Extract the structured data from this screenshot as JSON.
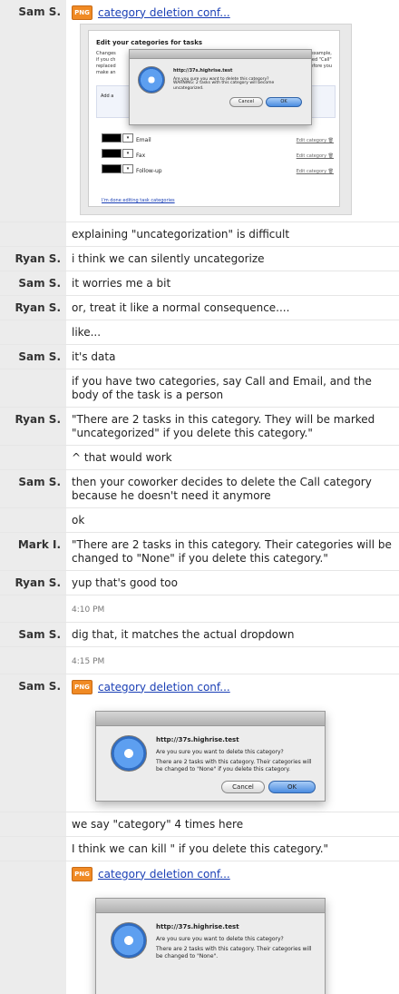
{
  "messages": [
    {
      "author": "Sam S.",
      "file": "category deletion conf..."
    },
    {
      "author": "",
      "text": "explaining \"uncategorization\" is difficult"
    },
    {
      "author": "Ryan S.",
      "text": "i think we can silently uncategorize"
    },
    {
      "author": "Sam S.",
      "text": "it worries me a bit"
    },
    {
      "author": "Ryan S.",
      "text": "or, treat it like a normal consequence...."
    },
    {
      "author": "",
      "text": "like..."
    },
    {
      "author": "Sam S.",
      "text": "it's data"
    },
    {
      "author": "",
      "text": "if you have two categories, say Call and Email, and the body of the task is a person"
    },
    {
      "author": "Ryan S.",
      "text": "\"There are 2 tasks in this category. They will be marked \"uncategorized\" if you delete this category.\""
    },
    {
      "author": "",
      "text": "^ that would work"
    },
    {
      "author": "Sam S.",
      "text": "then your coworker decides to delete the Call category because he doesn't need it anymore"
    },
    {
      "author": "",
      "text": "ok"
    },
    {
      "author": "Mark I.",
      "text": "\"There are 2 tasks in this category. Their categories will be changed to \"None\" if you delete this category.\""
    },
    {
      "author": "Ryan S.",
      "text": "yup that's good too"
    },
    {
      "time": "4:10 PM"
    },
    {
      "author": "Sam S.",
      "text": "dig that, it matches the actual dropdown"
    },
    {
      "time": "4:15 PM"
    },
    {
      "author": "Sam S.",
      "file": "category deletion conf..."
    },
    {
      "author": "",
      "text": "we say \"category\" 4 times here"
    },
    {
      "author": "",
      "text": "I think we can kill \" if you delete this category.\""
    },
    {
      "author": "",
      "file": "category deletion conf..."
    }
  ],
  "file_icon_label": "PNG",
  "shot1": {
    "title": "Edit your categories for tasks",
    "text_left": "Changes\nif you ch\nreplaced\nmake an",
    "text_right": "r example,\nrked \"Call\"\nbefore you",
    "add_label": "Add a",
    "categories": [
      {
        "name": "Email",
        "edit": "Edit category"
      },
      {
        "name": "Fax",
        "edit": "Edit category"
      },
      {
        "name": "Follow-up",
        "edit": "Edit category"
      }
    ],
    "done_link": "I'm done editing task categories",
    "dialog": {
      "host": "http://37s.highrise.test",
      "question": "Are you sure you want to delete this category?",
      "warning": "WARNING: 2 tasks with this category will become uncategorized.",
      "cancel": "Cancel",
      "ok": "OK"
    }
  },
  "dialog2": {
    "host": "http://37s.highrise.test",
    "question": "Are you sure you want to delete this category?",
    "message": "There are 2 tasks with this category. Their categories will be changed to \"None\" if you delete this category.",
    "cancel": "Cancel",
    "ok": "OK"
  },
  "dialog3": {
    "host": "http://37s.highrise.test",
    "question": "Are you sure you want to delete this category?",
    "message": "There are 2 tasks with this category. Their categories will be changed to \"None\"."
  }
}
